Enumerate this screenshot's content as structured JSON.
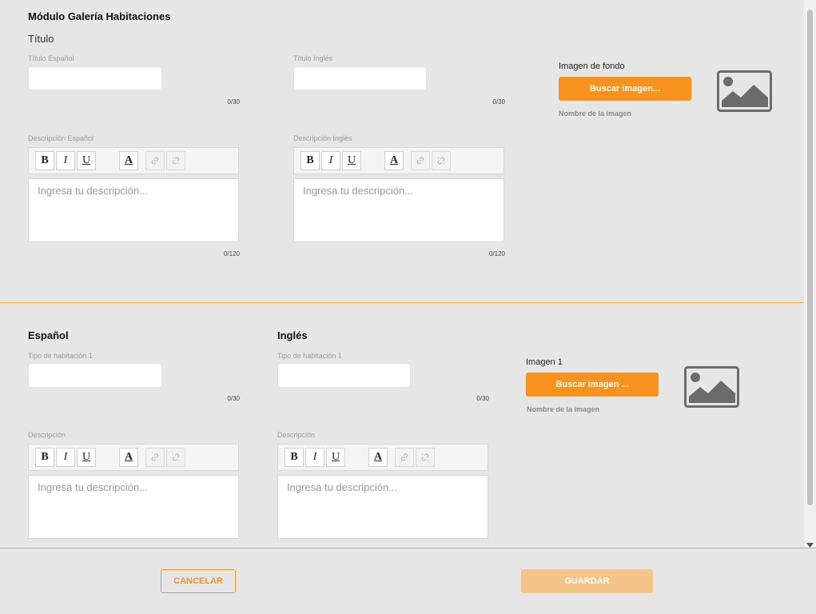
{
  "header": {
    "title": "Módulo Galería Habitaciones",
    "section": "Título"
  },
  "title_section": {
    "es_label": "Título Español",
    "en_label": "Título Inglés",
    "es_value": "",
    "en_value": "",
    "es_counter": "0/30",
    "en_counter": "0/30",
    "desc_es_label": "Descripción Español",
    "desc_en_label": "Descripción Inglés",
    "desc_placeholder": "Ingresa tu descripción...",
    "desc_es_counter": "0/120",
    "desc_en_counter": "0/120",
    "bg_image_label": "Imagen de fondo",
    "bg_image_button": "Buscar imagen...",
    "bg_image_name": "Nombre de la imagen"
  },
  "toolbar": {
    "bold": "B",
    "italic": "I",
    "underline": "U",
    "color": "A",
    "link_icon": "link-icon",
    "unlink_icon": "unlink-icon"
  },
  "room_section": {
    "es_heading": "Español",
    "en_heading": "Inglés",
    "es_type_label": "Tipo de habitación 1",
    "en_type_label": "Tipo de habitación 1",
    "es_type_counter": "0/30",
    "en_type_counter": "0/30",
    "es_desc_label": "Descripción",
    "en_desc_label": "Descripción",
    "desc_placeholder": "Ingresa tu descripción...",
    "image_label": "Imagen 1",
    "image_button": "Buscar imagen ...",
    "image_name": "Nombre de la imagen"
  },
  "footer": {
    "cancel": "CANCELAR",
    "save": "GUARDAR"
  },
  "colors": {
    "accent": "#f7921e",
    "save_disabled": "#f5c488",
    "background": "#e6e6e6"
  }
}
